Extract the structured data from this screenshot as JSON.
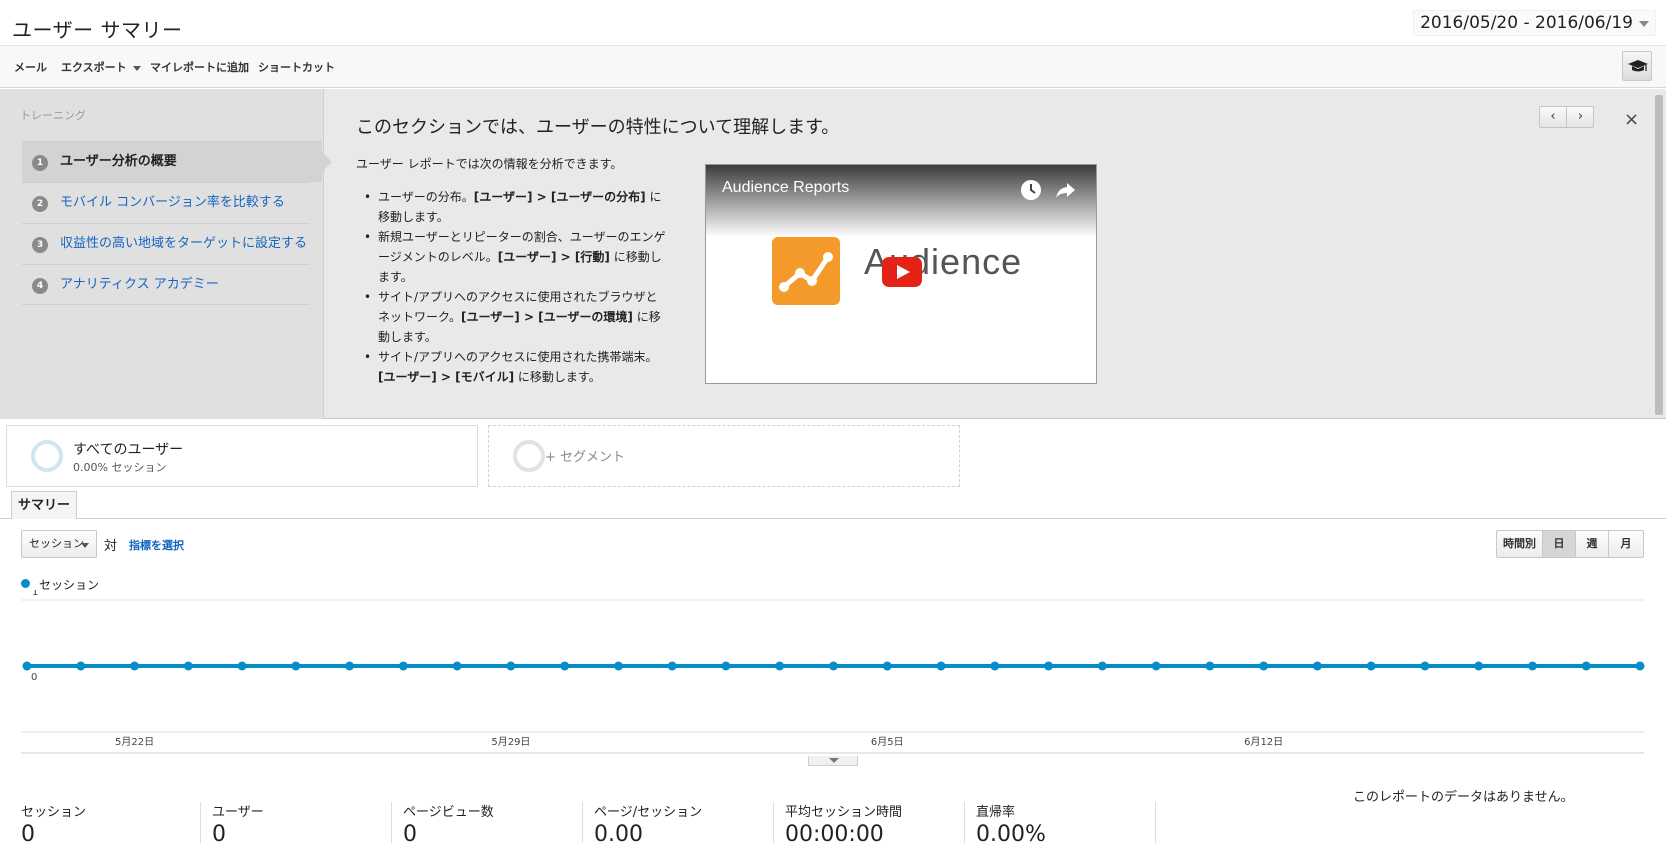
{
  "header": {
    "title": "ユーザー サマリー",
    "date_range": "2016/05/20 - 2016/06/19"
  },
  "toolbar": {
    "items": [
      "メール",
      "エクスポート",
      "マイレポートに追加",
      "ショートカット"
    ]
  },
  "training": {
    "label": "トレーニング",
    "steps": [
      {
        "num": "1",
        "label": "ユーザー分析の概要"
      },
      {
        "num": "2",
        "label": "モバイル コンバージョン率を比較する"
      },
      {
        "num": "3",
        "label": "収益性の高い地域をターゲットに設定する"
      },
      {
        "num": "4",
        "label": "アナリティクス アカデミー"
      }
    ],
    "heading": "このセクションでは、ユーザーの特性について理解します。",
    "intro": "ユーザー レポートでは次の情報を分析できます。",
    "bullets": [
      {
        "text": "ユーザーの分布。",
        "bold": "[ユーザー] > [ユーザーの分布]",
        "tail": " に移動します。"
      },
      {
        "text": "新規ユーザーとリピーターの割合、ユーザーのエンゲージメントのレベル。",
        "bold": "[ユーザー] > [行動]",
        "tail": " に移動します。"
      },
      {
        "text": "サイト/アプリへのアクセスに使用されたブラウザとネットワーク。",
        "bold": "[ユーザー] > [ユーザーの環境]",
        "tail": " に移動します。"
      },
      {
        "text": "サイト/アプリへのアクセスに使用された携帯端末。",
        "bold": "[ユーザー] > [モバイル]",
        "tail": " に移動します。"
      }
    ],
    "video": {
      "title": "Audience Reports",
      "word": "Audience"
    },
    "pager_prev": "‹",
    "pager_next": "›",
    "close": "×"
  },
  "segments": {
    "main_name": "すべてのユーザー",
    "main_sub": "0.00% セッション",
    "add_label": "+ セグメント"
  },
  "tabs": {
    "summary": "サマリー"
  },
  "controls": {
    "metric": "セッション",
    "vs": "対",
    "pick_metric": "指標を選択",
    "granularity": [
      {
        "label": "時間別",
        "active": false
      },
      {
        "label": "日",
        "active": true
      },
      {
        "label": "週",
        "active": false
      },
      {
        "label": "月",
        "active": false
      }
    ]
  },
  "colors": {
    "series": "#058dc7",
    "link": "#1565c0"
  },
  "chart_data": {
    "type": "line",
    "series": [
      {
        "name": "セッション",
        "values": [
          0,
          0,
          0,
          0,
          0,
          0,
          0,
          0,
          0,
          0,
          0,
          0,
          0,
          0,
          0,
          0,
          0,
          0,
          0,
          0,
          0,
          0,
          0,
          0,
          0,
          0,
          0,
          0,
          0,
          0,
          0
        ]
      }
    ],
    "x": [
      "2016-05-20",
      "2016-05-21",
      "2016-05-22",
      "2016-05-23",
      "2016-05-24",
      "2016-05-25",
      "2016-05-26",
      "2016-05-27",
      "2016-05-28",
      "2016-05-29",
      "2016-05-30",
      "2016-05-31",
      "2016-06-01",
      "2016-06-02",
      "2016-06-03",
      "2016-06-04",
      "2016-06-05",
      "2016-06-06",
      "2016-06-07",
      "2016-06-08",
      "2016-06-09",
      "2016-06-10",
      "2016-06-11",
      "2016-06-12",
      "2016-06-13",
      "2016-06-14",
      "2016-06-15",
      "2016-06-16",
      "2016-06-17",
      "2016-06-18",
      "2016-06-19"
    ],
    "x_tick_labels": [
      {
        "label": "5月22日",
        "index": 2
      },
      {
        "label": "5月29日",
        "index": 9
      },
      {
        "label": "6月5日",
        "index": 16
      },
      {
        "label": "6月12日",
        "index": 23
      }
    ],
    "y_tick_labels": [
      "1",
      "0"
    ],
    "ylim": [
      0,
      1
    ],
    "grid": true,
    "legend": "top-left"
  },
  "stats": [
    {
      "label": "セッション",
      "value": "0"
    },
    {
      "label": "ユーザー",
      "value": "0"
    },
    {
      "label": "ページビュー数",
      "value": "0"
    },
    {
      "label": "ページ/セッション",
      "value": "0.00"
    },
    {
      "label": "平均セッション時間",
      "value": "00:00:00"
    },
    {
      "label": "直帰率",
      "value": "0.00%"
    }
  ],
  "no_data_message": "このレポートのデータはありません。"
}
